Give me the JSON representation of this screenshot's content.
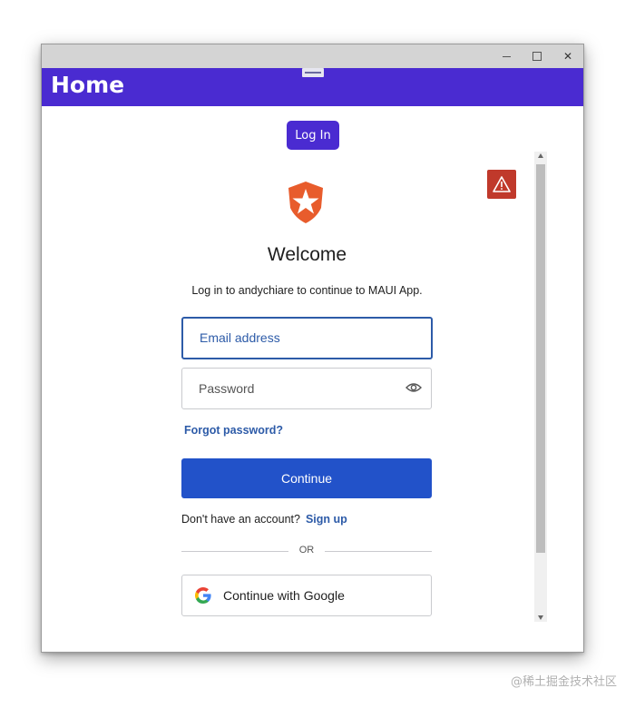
{
  "window": {
    "controls": {
      "minimize": "",
      "maximize": "",
      "close": "✕"
    }
  },
  "appbar": {
    "title": "Home"
  },
  "app": {
    "login_button": "Log In"
  },
  "auth": {
    "welcome": "Welcome",
    "subtitle": "Log in to andychiare to continue to MAUI App.",
    "email_placeholder": "Email address",
    "password_placeholder": "Password",
    "forgot_password": "Forgot password?",
    "continue_button": "Continue",
    "no_account_text": "Don't have an account?",
    "signup_link": "Sign up",
    "divider": "OR",
    "google_button": "Continue with Google"
  },
  "icons": {
    "warning": "warning-icon",
    "logo": "auth0-shield-icon",
    "eye": "eye-icon",
    "google": "google-icon"
  },
  "colors": {
    "appbar": "#4a2bd1",
    "primary_button": "#2252c9",
    "link": "#2d5ba8",
    "logo": "#e85c2c",
    "warning": "#c0392b"
  },
  "watermark": "@稀土掘金技术社区"
}
